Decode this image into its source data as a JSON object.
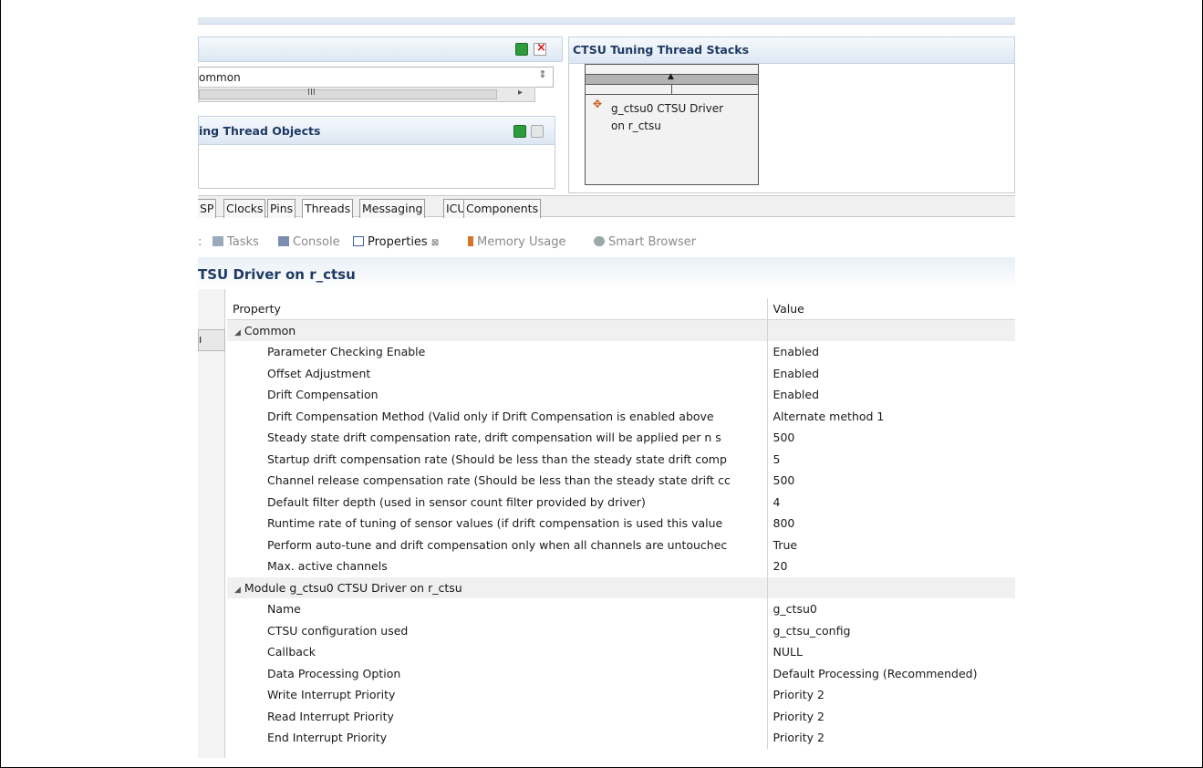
{
  "top_panes": {
    "left_common_combo": "ommon",
    "hscroll_grip": "III",
    "objects_title": "ing Thread Objects",
    "stacks_title": "CTSU Tuning Thread Stacks",
    "stack_box_label_line1": "g_ctsu0 CTSU Driver",
    "stack_box_label_line2": "on r_ctsu"
  },
  "editor_tabs": [
    "SP",
    "Clocks",
    "Pins",
    "Threads",
    "Messaging",
    "ICU",
    "Components"
  ],
  "view_tabs": {
    "tasks": "Tasks",
    "console": "Console",
    "properties": "Properties",
    "properties_close": "⊠",
    "memory": "Memory Usage",
    "browser": "Smart Browser"
  },
  "properties_title": "TSU Driver on r_ctsu",
  "table": {
    "headers": {
      "property": "Property",
      "value": "Value"
    },
    "rows": [
      {
        "type": "cat",
        "property": "Common",
        "value": ""
      },
      {
        "type": "item",
        "property": "Parameter Checking Enable",
        "value": "Enabled"
      },
      {
        "type": "item",
        "property": "Offset Adjustment",
        "value": "Enabled"
      },
      {
        "type": "item",
        "property": "Drift Compensation",
        "value": "Enabled"
      },
      {
        "type": "item",
        "property": "Drift Compensation Method (Valid only if Drift Compensation is enabled above",
        "value": "Alternate method 1"
      },
      {
        "type": "item",
        "property": "Steady state drift compensation rate, drift compensation will be applied per n s",
        "value": "500"
      },
      {
        "type": "item",
        "property": "Startup drift compensation rate (Should be less than the steady state drift comp",
        "value": "5"
      },
      {
        "type": "item",
        "property": "Channel release compensation rate (Should be less than the steady state drift cc",
        "value": "500"
      },
      {
        "type": "item",
        "property": "Default filter depth (used in sensor count filter provided by driver)",
        "value": "4"
      },
      {
        "type": "item",
        "property": "Runtime rate of tuning of sensor values (if drift compensation is used this value",
        "value": "800"
      },
      {
        "type": "item",
        "property": "Perform auto-tune and drift compensation only when all channels are untouchec",
        "value": "True"
      },
      {
        "type": "item",
        "property": "Max. active channels",
        "value": "20"
      },
      {
        "type": "cat",
        "property": "Module g_ctsu0 CTSU Driver on r_ctsu",
        "value": ""
      },
      {
        "type": "item",
        "property": "Name",
        "value": "g_ctsu0"
      },
      {
        "type": "item",
        "property": "CTSU configuration used",
        "value": "g_ctsu_config"
      },
      {
        "type": "item",
        "property": "Callback",
        "value": "NULL"
      },
      {
        "type": "item",
        "property": "Data Processing Option",
        "value": "Default Processing (Recommended)"
      },
      {
        "type": "item",
        "property": "Write Interrupt Priority",
        "value": "Priority 2"
      },
      {
        "type": "item",
        "property": "Read Interrupt Priority",
        "value": "Priority 2"
      },
      {
        "type": "item",
        "property": "End Interrupt Priority",
        "value": "Priority 2"
      }
    ]
  }
}
